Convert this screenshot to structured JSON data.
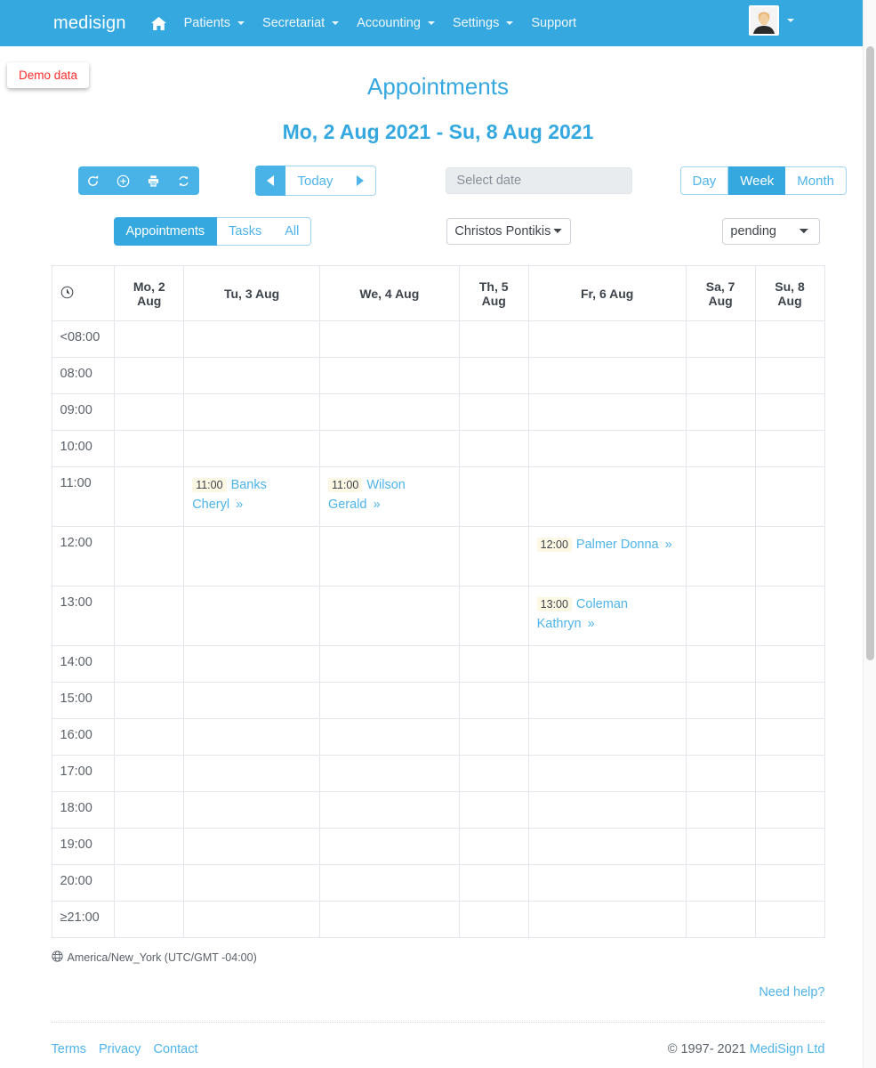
{
  "navbar": {
    "brand": "medisign",
    "home_icon": "home-icon",
    "items": [
      {
        "label": "Patients",
        "has_caret": true
      },
      {
        "label": "Secretariat",
        "has_caret": true
      },
      {
        "label": "Accounting",
        "has_caret": true
      },
      {
        "label": "Settings",
        "has_caret": true
      },
      {
        "label": "Support",
        "has_caret": false
      }
    ],
    "avatar_icon": "user-avatar",
    "avatar_caret": true,
    "background_color": "#35a8e0"
  },
  "demo_badge": {
    "label": "Demo data",
    "color": "#fc2b2b"
  },
  "header": {
    "title": "Appointments",
    "date_range": "Mo, 2 Aug 2021 - Su, 8 Aug 2021",
    "accent_color": "#35a8e0"
  },
  "toolbar": {
    "action_buttons": [
      {
        "name": "refresh-button",
        "icon": "refresh-icon"
      },
      {
        "name": "add-appointment-button",
        "icon": "plus-circle-icon"
      },
      {
        "name": "print-button",
        "icon": "printer-icon"
      },
      {
        "name": "sync-button",
        "icon": "sync-icon"
      }
    ],
    "prev_label": "",
    "today_label": "Today",
    "next_label": "",
    "date_picker_placeholder": "Select date",
    "date_picker_value": "",
    "views": [
      {
        "label": "Day",
        "active": false
      },
      {
        "label": "Week",
        "active": true
      },
      {
        "label": "Month",
        "active": false
      }
    ],
    "tabs": [
      {
        "label": "Appointments",
        "active": true
      },
      {
        "label": "Tasks",
        "active": false
      },
      {
        "label": "All",
        "active": false
      }
    ],
    "doctor_select": {
      "value": "Christos Pontikis",
      "options": [
        "Christos Pontikis"
      ]
    },
    "status_select": {
      "value": "pending",
      "options": [
        "pending"
      ]
    }
  },
  "calendar": {
    "time_column_icon": "clock-icon",
    "day_headers": [
      "Mo, 2 Aug",
      "Tu, 3 Aug",
      "We, 4 Aug",
      "Th, 5 Aug",
      "Fr, 6 Aug",
      "Sa, 7 Aug",
      "Su, 8 Aug"
    ],
    "rows": [
      {
        "time": "<08:00",
        "tall": false,
        "appointments": {}
      },
      {
        "time": "08:00",
        "tall": false,
        "appointments": {}
      },
      {
        "time": "09:00",
        "tall": false,
        "appointments": {}
      },
      {
        "time": "10:00",
        "tall": false,
        "appointments": {}
      },
      {
        "time": "11:00",
        "tall": true,
        "appointments": {
          "1": {
            "time": "11:00",
            "name": "Banks Cheryl",
            "arrow": "»"
          },
          "2": {
            "time": "11:00",
            "name": "Wilson Gerald",
            "arrow": "»"
          }
        }
      },
      {
        "time": "12:00",
        "tall": true,
        "appointments": {
          "4": {
            "time": "12:00",
            "name": "Palmer Donna",
            "arrow": "»"
          }
        }
      },
      {
        "time": "13:00",
        "tall": true,
        "appointments": {
          "4": {
            "time": "13:00",
            "name": "Coleman Kathryn",
            "arrow": "»"
          }
        }
      },
      {
        "time": "14:00",
        "tall": false,
        "appointments": {}
      },
      {
        "time": "15:00",
        "tall": false,
        "appointments": {}
      },
      {
        "time": "16:00",
        "tall": false,
        "appointments": {}
      },
      {
        "time": "17:00",
        "tall": false,
        "appointments": {}
      },
      {
        "time": "18:00",
        "tall": false,
        "appointments": {}
      },
      {
        "time": "19:00",
        "tall": false,
        "appointments": {}
      },
      {
        "time": "20:00",
        "tall": false,
        "appointments": {}
      },
      {
        "time": "≥21:00",
        "tall": false,
        "appointments": {}
      }
    ]
  },
  "timezone": {
    "icon": "globe-icon",
    "label": "America/New_York (UTC/GMT -04:00)"
  },
  "help": {
    "label": "Need help?"
  },
  "footer": {
    "links": [
      "Terms",
      "Privacy",
      "Contact"
    ],
    "copyright": "© 1997- 2021",
    "company": "MediSign Ltd"
  }
}
